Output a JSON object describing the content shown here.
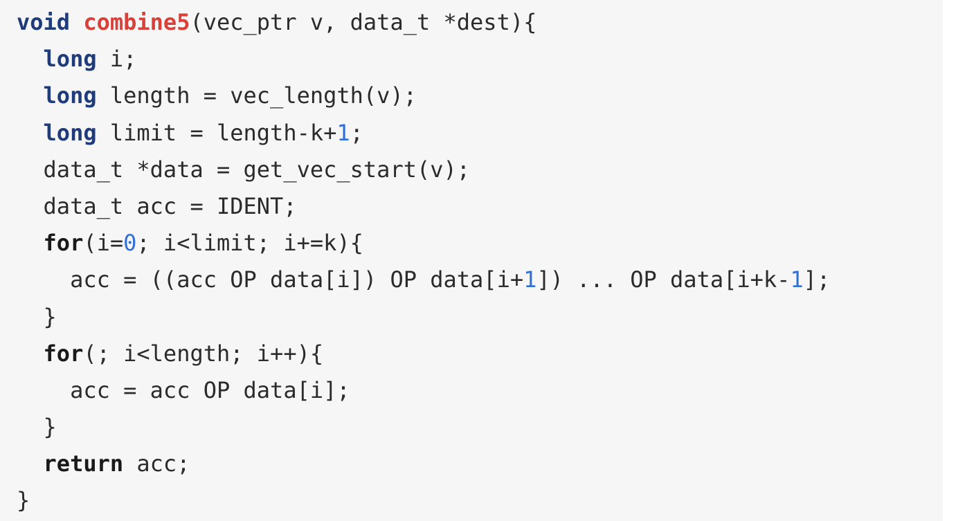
{
  "colors": {
    "background": "#f6f6f6",
    "text": "#2b2b2b",
    "keyword_type": "#1f3b7a",
    "keyword_flow": "#1a1a1a",
    "function_name": "#d9403a",
    "number": "#2f6fd6"
  },
  "code": {
    "language": "c",
    "lines": [
      [
        {
          "t": "void",
          "k": "kw_type"
        },
        {
          "t": " ",
          "k": "plain"
        },
        {
          "t": "combine5",
          "k": "fn"
        },
        {
          "t": "(vec_ptr v, data_t *dest){",
          "k": "plain"
        }
      ],
      [
        {
          "t": "  ",
          "k": "plain"
        },
        {
          "t": "long",
          "k": "kw_type"
        },
        {
          "t": " i;",
          "k": "plain"
        }
      ],
      [
        {
          "t": "  ",
          "k": "plain"
        },
        {
          "t": "long",
          "k": "kw_type"
        },
        {
          "t": " length = vec_length(v);",
          "k": "plain"
        }
      ],
      [
        {
          "t": "  ",
          "k": "plain"
        },
        {
          "t": "long",
          "k": "kw_type"
        },
        {
          "t": " limit = length-k+",
          "k": "plain"
        },
        {
          "t": "1",
          "k": "num"
        },
        {
          "t": ";",
          "k": "plain"
        }
      ],
      [
        {
          "t": "  data_t *data = get_vec_start(v);",
          "k": "plain"
        }
      ],
      [
        {
          "t": "  data_t acc = IDENT;",
          "k": "plain"
        }
      ],
      [
        {
          "t": "  ",
          "k": "plain"
        },
        {
          "t": "for",
          "k": "kw_flow"
        },
        {
          "t": "(i=",
          "k": "plain"
        },
        {
          "t": "0",
          "k": "num"
        },
        {
          "t": "; i<limit; i+=k){",
          "k": "plain"
        }
      ],
      [
        {
          "t": "    acc = ((acc OP data[i]) OP data[i+",
          "k": "plain"
        },
        {
          "t": "1",
          "k": "num"
        },
        {
          "t": "]) ... OP data[i+k-",
          "k": "plain"
        },
        {
          "t": "1",
          "k": "num"
        },
        {
          "t": "];",
          "k": "plain"
        }
      ],
      [
        {
          "t": "  }",
          "k": "plain"
        }
      ],
      [
        {
          "t": "  ",
          "k": "plain"
        },
        {
          "t": "for",
          "k": "kw_flow"
        },
        {
          "t": "(; i<length; i++){",
          "k": "plain"
        }
      ],
      [
        {
          "t": "    acc = acc OP data[i];",
          "k": "plain"
        }
      ],
      [
        {
          "t": "  }",
          "k": "plain"
        }
      ],
      [
        {
          "t": "  ",
          "k": "plain"
        },
        {
          "t": "return",
          "k": "kw_flow"
        },
        {
          "t": " acc;",
          "k": "plain"
        }
      ],
      [
        {
          "t": "}",
          "k": "plain"
        }
      ]
    ]
  }
}
